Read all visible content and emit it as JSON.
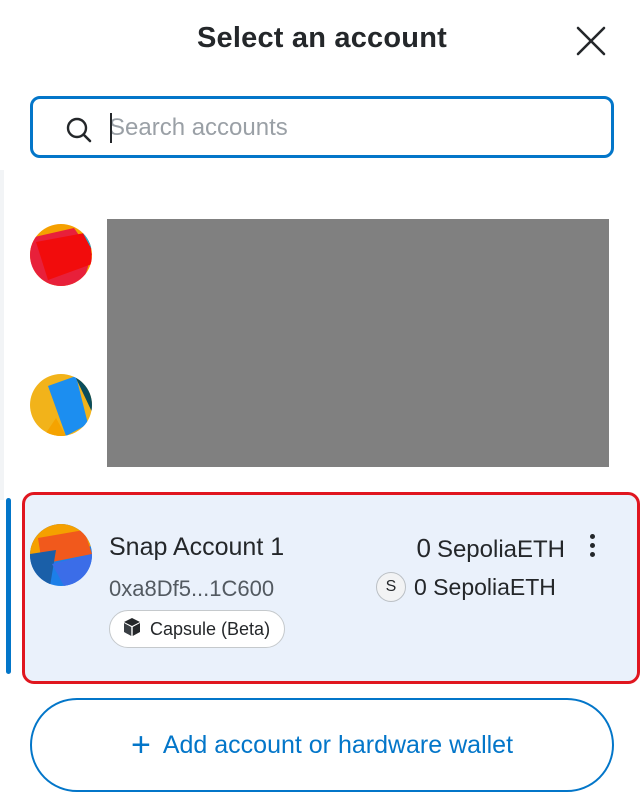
{
  "header": {
    "title": "Select an account"
  },
  "search": {
    "placeholder": "Search accounts",
    "value": ""
  },
  "accounts": [
    {
      "avatar": "jazzicon-red-orange"
    },
    {
      "avatar": "jazzicon-yellow-blue"
    },
    {
      "avatar": "jazzicon-orange-blue",
      "name": "Snap Account 1",
      "address": "0xa8Df5...1C600",
      "badge_label": "Capsule (Beta)",
      "badge_icon": "cube-icon",
      "balance_primary_value": "0",
      "balance_primary_unit": "SepoliaETH",
      "token_symbol": "S",
      "balance_secondary": "0 SepoliaETH",
      "selected": true
    }
  ],
  "footer": {
    "add_button_icon": "+",
    "add_button_label": "Add account or hardware wallet"
  },
  "colors": {
    "accent": "#0376c9",
    "highlight_border": "#e0161f",
    "selected_bg": "#eaf1fb",
    "redaction": "#808080"
  }
}
